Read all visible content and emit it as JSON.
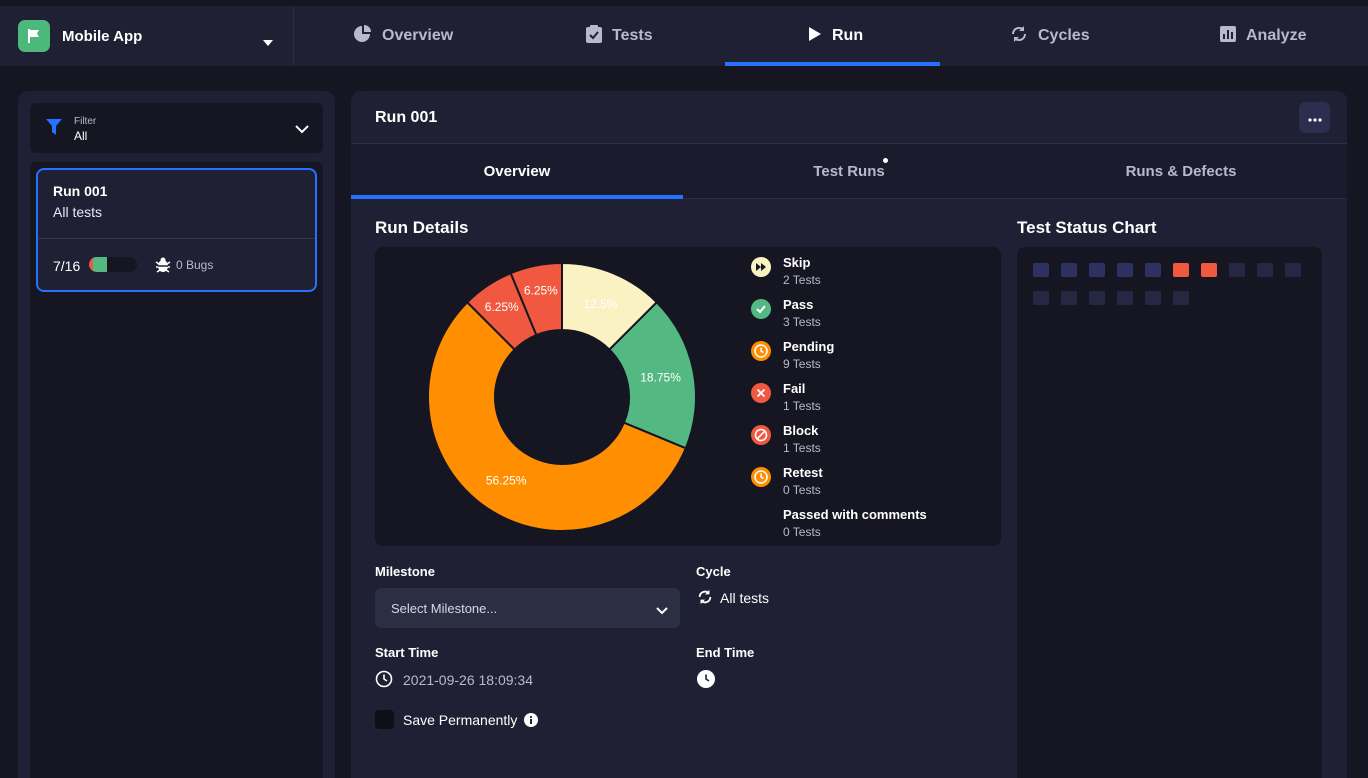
{
  "app": {
    "name": "Mobile App"
  },
  "nav": {
    "items": [
      {
        "label": "Overview",
        "icon": "pie-chart-icon"
      },
      {
        "label": "Tests",
        "icon": "clipboard-check-icon"
      },
      {
        "label": "Run",
        "icon": "play-icon"
      },
      {
        "label": "Cycles",
        "icon": "refresh-icon"
      },
      {
        "label": "Analyze",
        "icon": "bar-chart-icon"
      }
    ],
    "active": "Run"
  },
  "filter": {
    "label": "Filter",
    "value": "All"
  },
  "runs": [
    {
      "title": "Run 001",
      "subtitle": "All tests",
      "progress_text": "7/16",
      "progress_fraction": 0.4375,
      "bugs": "0 Bugs"
    }
  ],
  "main": {
    "title": "Run 001",
    "tabs": [
      {
        "label": "Overview"
      },
      {
        "label": "Test Runs"
      },
      {
        "label": "Runs & Defects"
      }
    ],
    "active_tab": "Overview",
    "run_details_title": "Run Details",
    "status_chart_title": "Test Status Chart",
    "milestone": {
      "label": "Milestone",
      "placeholder": "Select Milestone..."
    },
    "cycle": {
      "label": "Cycle",
      "value": "All tests"
    },
    "start_time": {
      "label": "Start Time",
      "value": "2021-09-26 18:09:34"
    },
    "end_time": {
      "label": "End Time",
      "value": ""
    },
    "save_permanently": {
      "label": "Save Permanently",
      "checked": false
    }
  },
  "legend": [
    {
      "label": "Skip",
      "count": "2 Tests",
      "color": "#fbf2c4",
      "icon": "fast-forward-icon"
    },
    {
      "label": "Pass",
      "count": "3 Tests",
      "color": "#53b882",
      "icon": "check-icon"
    },
    {
      "label": "Pending",
      "count": "9 Tests",
      "color": "#ff8f00",
      "icon": "clock-icon"
    },
    {
      "label": "Fail",
      "count": "1 Tests",
      "color": "#f0593f",
      "icon": "x-icon"
    },
    {
      "label": "Block",
      "count": "1 Tests",
      "color": "#f0593f",
      "icon": "block-icon"
    },
    {
      "label": "Retest",
      "count": "0 Tests",
      "color": "#ff8f00",
      "icon": "retest-icon"
    },
    {
      "label": "Passed with comments",
      "count": "0 Tests",
      "color": "",
      "icon": ""
    }
  ],
  "chart_data": {
    "type": "pie",
    "labels": [
      "Skip",
      "Pass",
      "Pending",
      "Fail",
      "Block"
    ],
    "values": [
      12.5,
      18.75,
      56.25,
      6.25,
      6.25
    ],
    "data_labels": [
      "12.5%",
      "18.75%",
      "56.25%",
      "6.25%",
      "6.25%"
    ],
    "colors": [
      "#fbf2c4",
      "#53b882",
      "#ff8f00",
      "#f0593f",
      "#f0593f"
    ],
    "title": ""
  },
  "test_status_chart": {
    "statuses": [
      "pending",
      "pending",
      "pending",
      "pending",
      "pending",
      "fail",
      "block",
      "pass",
      "pass",
      "pass",
      "skip",
      "skip",
      "pending",
      "pending",
      "pending",
      "pending"
    ]
  }
}
